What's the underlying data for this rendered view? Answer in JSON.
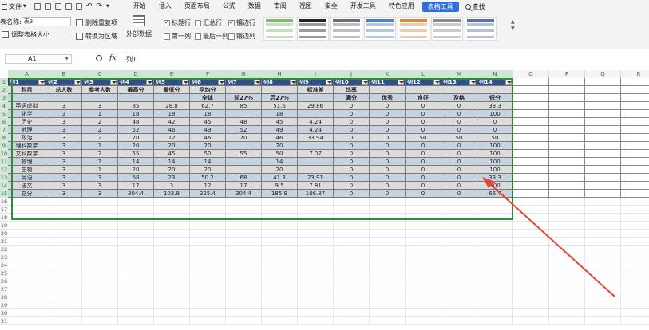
{
  "menubar": {
    "file_label": "文件",
    "tabs": [
      "开始",
      "插入",
      "页面布局",
      "公式",
      "数据",
      "审阅",
      "视图",
      "安全",
      "开发工具",
      "特色应用",
      "表格工具"
    ],
    "active_tab": "表格工具",
    "search_label": "查找"
  },
  "ribbon": {
    "table_name_label": "表名称:",
    "table_name_value": "表3",
    "resize_label": "调整表格大小",
    "remove_dup_label": "删除重复项",
    "convert_label": "转换为区域",
    "external_label": "外部数据",
    "options": [
      {
        "label": "标题行",
        "checked": true
      },
      {
        "label": "汇总行",
        "checked": false
      },
      {
        "label": "镶边行",
        "checked": true
      },
      {
        "label": "第一列",
        "checked": false
      },
      {
        "label": "最后一列",
        "checked": false
      },
      {
        "label": "镶边列",
        "checked": false
      }
    ],
    "style_colors": [
      "#7dbb6a",
      "#222222",
      "#6e6e6e",
      "#4a82c6",
      "#d98a3a",
      "#8c8c8c",
      "#5b6fb0"
    ]
  },
  "formula_bar": {
    "cell_ref": "A1",
    "fx": "fx",
    "content": "列1"
  },
  "grid": {
    "columns": [
      "A",
      "B",
      "C",
      "D",
      "E",
      "F",
      "G",
      "H",
      "I",
      "J",
      "K",
      "L",
      "M",
      "N",
      "O",
      "P",
      "Q",
      "R"
    ],
    "row_numbers": [
      "1",
      "2",
      "3",
      "4",
      "5",
      "6",
      "7",
      "8",
      "9",
      "10",
      "11",
      "12",
      "13",
      "14",
      "15",
      "16",
      "17",
      "18",
      "19",
      "20",
      "21",
      "22",
      "23",
      "24",
      "25",
      "26",
      "27",
      "28",
      "29",
      "30",
      "31"
    ],
    "header_row": [
      "列1",
      "列2",
      "列3",
      "列4",
      "列5",
      "列6",
      "列7",
      "列8",
      "列9",
      "列10",
      "列11",
      "列12",
      "列13",
      "列14"
    ],
    "rows": [
      [
        "科目",
        "总人数",
        "参考人数",
        "最高分",
        "最低分",
        "平均分",
        "",
        "",
        "标准差",
        "比率",
        "",
        "",
        "",
        ""
      ],
      [
        "",
        "",
        "",
        "",
        "",
        "全体",
        "前27%",
        "后27%",
        "",
        "满分",
        "优秀",
        "良好",
        "及格",
        "低分"
      ],
      [
        "英语虚拟",
        "3",
        "3",
        "85",
        "28.8",
        "62.7",
        "85",
        "51.6",
        "29.86",
        "0",
        "0",
        "0",
        "0",
        "33.3"
      ],
      [
        "化学",
        "3",
        "1",
        "18",
        "18",
        "18",
        "",
        "18",
        "",
        "0",
        "0",
        "0",
        "0",
        "100"
      ],
      [
        "历史",
        "3",
        "2",
        "48",
        "42",
        "45",
        "48",
        "45",
        "4.24",
        "0",
        "0",
        "0",
        "0",
        "0"
      ],
      [
        "地理",
        "3",
        "2",
        "52",
        "46",
        "49",
        "52",
        "49",
        "4.24",
        "0",
        "0",
        "0",
        "0",
        "0"
      ],
      [
        "政治",
        "3",
        "2",
        "70",
        "22",
        "46",
        "70",
        "46",
        "33.94",
        "0",
        "0",
        "50",
        "50",
        "50"
      ],
      [
        "理科数学",
        "3",
        "1",
        "20",
        "20",
        "20",
        "",
        "20",
        "",
        "0",
        "0",
        "0",
        "0",
        "100"
      ],
      [
        "文科数学",
        "3",
        "2",
        "55",
        "45",
        "50",
        "55",
        "50",
        "7.07",
        "0",
        "0",
        "0",
        "0",
        "100"
      ],
      [
        "物理",
        "3",
        "1",
        "14",
        "14",
        "14",
        "",
        "14",
        "",
        "0",
        "0",
        "0",
        "0",
        "100"
      ],
      [
        "生物",
        "3",
        "1",
        "20",
        "20",
        "20",
        "",
        "20",
        "",
        "0",
        "0",
        "0",
        "0",
        "100"
      ],
      [
        "英语",
        "3",
        "3",
        "68",
        "23",
        "50.2",
        "68",
        "41.3",
        "23.91",
        "0",
        "0",
        "0",
        "0",
        "33.3"
      ],
      [
        "语文",
        "3",
        "3",
        "17",
        "3",
        "12",
        "17",
        "9.5",
        "7.81",
        "0",
        "0",
        "0",
        "0",
        "100"
      ],
      [
        "总分",
        "3",
        "3",
        "304.4",
        "103.8",
        "225.4",
        "304.4",
        "185.9",
        "106.87",
        "0",
        "0",
        "0",
        "0",
        "66.7"
      ]
    ]
  }
}
